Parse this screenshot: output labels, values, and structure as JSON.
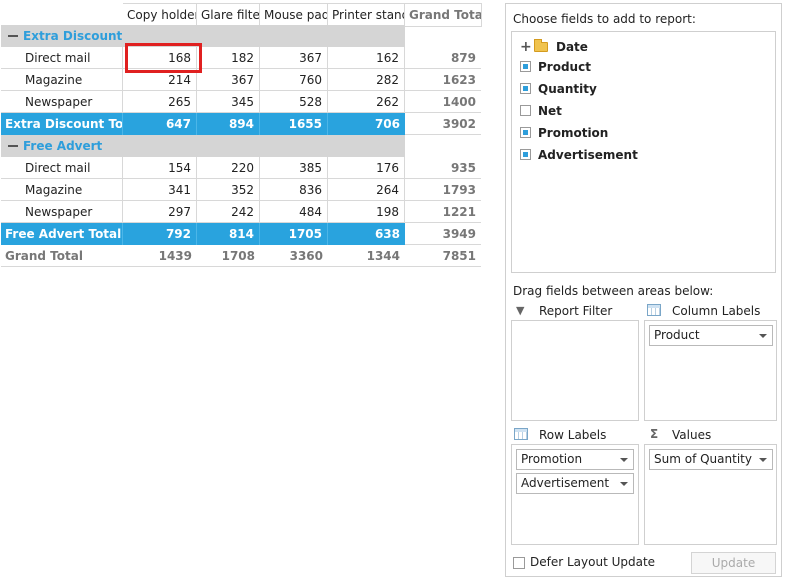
{
  "pivot": {
    "columns": [
      "Copy holder",
      "Glare filter",
      "Mouse pad",
      "Printer stand",
      "Grand Total"
    ],
    "groups": [
      {
        "name": "Extra Discount",
        "rows": [
          {
            "label": "Direct mail",
            "values": [
              "168",
              "182",
              "367",
              "162"
            ],
            "total": "879"
          },
          {
            "label": "Magazine",
            "values": [
              "214",
              "367",
              "760",
              "282"
            ],
            "total": "1623"
          },
          {
            "label": "Newspaper",
            "values": [
              "265",
              "345",
              "528",
              "262"
            ],
            "total": "1400"
          }
        ],
        "total_label": "Extra Discount Total",
        "totals": [
          "647",
          "894",
          "1655",
          "706"
        ],
        "grand": "3902"
      },
      {
        "name": "Free Advert",
        "rows": [
          {
            "label": "Direct mail",
            "values": [
              "154",
              "220",
              "385",
              "176"
            ],
            "total": "935"
          },
          {
            "label": "Magazine",
            "values": [
              "341",
              "352",
              "836",
              "264"
            ],
            "total": "1793"
          },
          {
            "label": "Newspaper",
            "values": [
              "297",
              "242",
              "484",
              "198"
            ],
            "total": "1221"
          }
        ],
        "total_label": "Free Advert Total",
        "totals": [
          "792",
          "814",
          "1705",
          "638"
        ],
        "grand": "3949"
      }
    ],
    "grand_total": {
      "label": "Grand Total",
      "values": [
        "1439",
        "1708",
        "3360",
        "1344"
      ],
      "total": "7851"
    }
  },
  "field_list": {
    "title": "Choose fields to add to report:",
    "fields": [
      {
        "label": "Date",
        "kind": "folder",
        "checked": false
      },
      {
        "label": "Product",
        "kind": "field",
        "checked": true
      },
      {
        "label": "Quantity",
        "kind": "field",
        "checked": true
      },
      {
        "label": "Net",
        "kind": "field",
        "checked": false
      },
      {
        "label": "Promotion",
        "kind": "field",
        "checked": true
      },
      {
        "label": "Advertisement",
        "kind": "field",
        "checked": true
      }
    ],
    "drag_hint": "Drag fields between areas below:",
    "areas": {
      "report_filter": {
        "title": "Report Filter",
        "items": []
      },
      "column_labels": {
        "title": "Column Labels",
        "items": [
          "Product"
        ]
      },
      "row_labels": {
        "title": "Row Labels",
        "items": [
          "Promotion",
          "Advertisement"
        ]
      },
      "values": {
        "title": "Values",
        "items": [
          "Sum of Quantity"
        ]
      }
    },
    "defer_label": "Defer Layout Update",
    "update_label": "Update"
  },
  "colors": {
    "accent": "#29A3DE",
    "group_bg": "#D5D5D5",
    "highlight": "#E02020"
  }
}
